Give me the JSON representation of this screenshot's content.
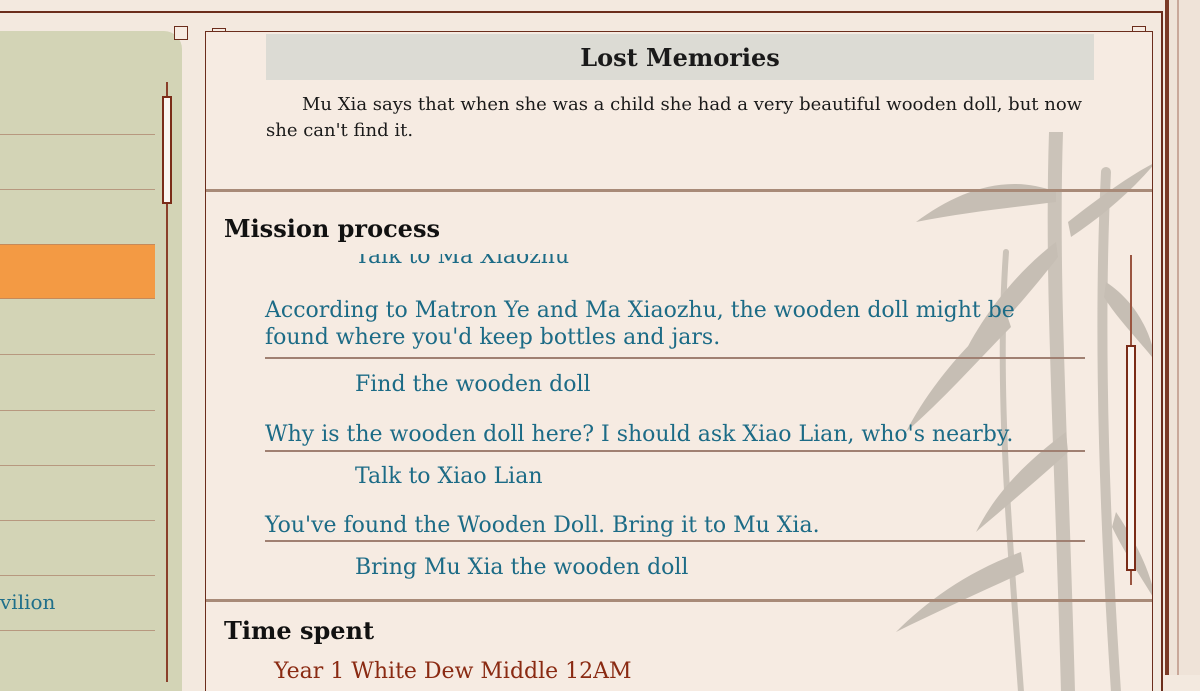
{
  "left_panel": {
    "items": [
      {
        "label": ""
      },
      {
        "label": ""
      },
      {
        "label": ""
      },
      {
        "label": "",
        "selected": true
      },
      {
        "label": ""
      },
      {
        "label": ""
      },
      {
        "label": ""
      },
      {
        "label": ""
      },
      {
        "label": ""
      },
      {
        "label": "vilion"
      }
    ]
  },
  "quest": {
    "title": "Lost Memories",
    "description": "Mu Xia says that when she was a child she had a very beautiful wooden doll, but now she can't find it."
  },
  "mission": {
    "heading": "Mission process",
    "steps": [
      {
        "task": "Talk to Ma Xiaozhu"
      },
      {
        "description": "According to Matron Ye and Ma Xiaozhu, the wooden doll might be found where you'd keep bottles and jars.",
        "task": "Find the wooden doll"
      },
      {
        "description": "Why is the wooden doll here? I should ask Xiao Lian, who's nearby.",
        "task": "Talk to Xiao Lian"
      },
      {
        "description": "You've found the Wooden Doll. Bring it to Mu Xia.",
        "task": "Bring Mu Xia the wooden doll"
      }
    ]
  },
  "time": {
    "heading": "Time spent",
    "value": "Year 1 White Dew Middle 12AM"
  },
  "colors": {
    "accent_orange": "#f39a44",
    "text_blue": "#1c6b86",
    "frame_brown": "#6b2d1c"
  }
}
